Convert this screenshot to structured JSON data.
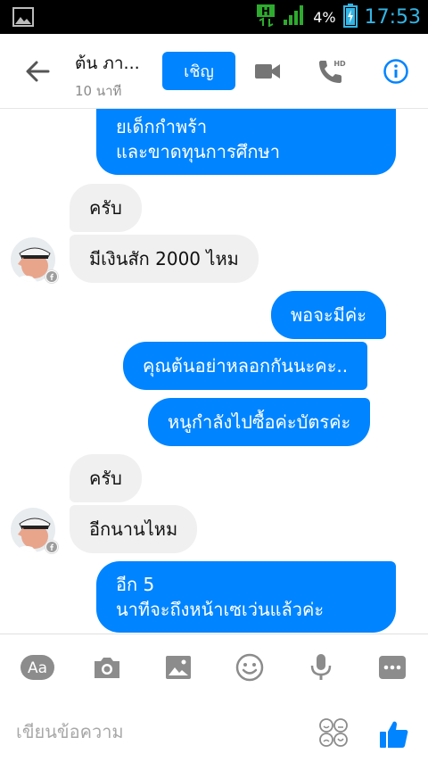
{
  "status_bar": {
    "battery_percent": "4%",
    "time": "17:53"
  },
  "header": {
    "contact_name": "ต้น ภา...",
    "contact_status": "10 นาที",
    "invite_label": "เชิญ",
    "hd_label": "HD",
    "icons": [
      "back-arrow-icon",
      "video-call-icon",
      "phone-hd-icon",
      "info-icon"
    ]
  },
  "messages": [
    {
      "sender": "me",
      "text": "ยเด็กกำพร้า\nและขาดทุนการศึกษา"
    },
    {
      "sender": "contact",
      "text": "ครับ"
    },
    {
      "sender": "contact",
      "text": "มีเงินสัก 2000 ไหม"
    },
    {
      "sender": "me",
      "text": "พอจะมีค่ะ"
    },
    {
      "sender": "me",
      "text": "คุณต้นอย่าหลอกกันนะคะ.."
    },
    {
      "sender": "me",
      "text": "หนูกำลังไปซื้อค่ะบัตรค่ะ"
    },
    {
      "sender": "contact",
      "text": "ครับ"
    },
    {
      "sender": "contact",
      "text": "อีกนานไหม"
    },
    {
      "sender": "me",
      "text": "อีก 5\nนาทีจะถึงหน้าเซเว่นแล้วค่ะ"
    }
  ],
  "composer": {
    "aa_label": "Aa",
    "placeholder": "เขียนข้อความ",
    "tools": [
      "text-format-icon",
      "camera-icon",
      "gallery-icon",
      "sticker-icon",
      "microphone-icon",
      "more-icon"
    ]
  },
  "colors": {
    "accent": "#0084ff",
    "incoming_bubble": "#f1f0f0",
    "status_blue": "#33b5e5"
  }
}
